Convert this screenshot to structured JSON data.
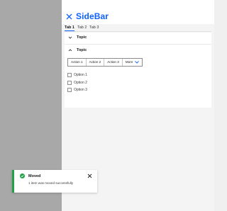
{
  "sidebar": {
    "title": "SideBar",
    "close_icon": "close-icon",
    "tabs": [
      {
        "label": "Tab 1",
        "active": true
      },
      {
        "label": "Tab 2",
        "active": false
      },
      {
        "label": "Tab 3",
        "active": false
      }
    ],
    "accordions": [
      {
        "label": "Topic",
        "expanded": false
      },
      {
        "label": "Topic",
        "expanded": true
      }
    ],
    "actions": [
      "Action 1",
      "Action 2",
      "Action 3"
    ],
    "more_label": "More",
    "options": [
      "Option 1",
      "Option 2",
      "Option 3"
    ]
  },
  "toast": {
    "title": "Moved",
    "subtitle": "1 item was moved successfully",
    "status_color": "#24a148"
  },
  "colors": {
    "accent": "#0f62fe",
    "backdrop": "#a8a8a8"
  }
}
